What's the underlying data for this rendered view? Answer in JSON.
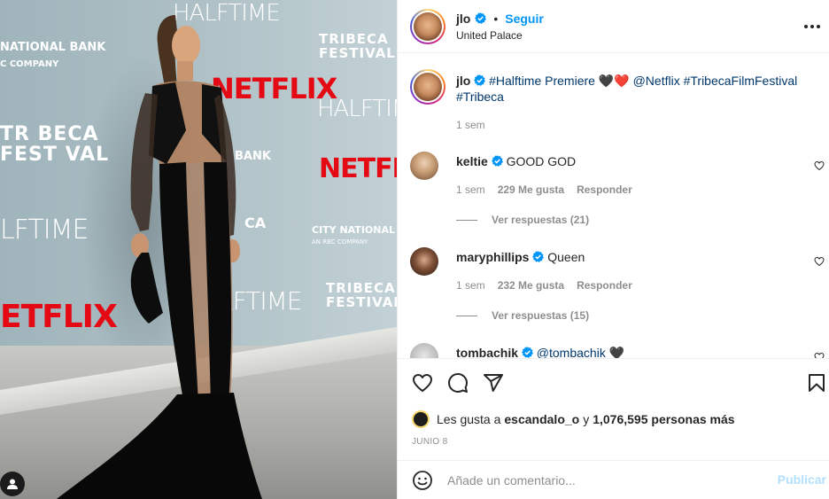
{
  "header": {
    "username": "jlo",
    "separator": "•",
    "follow_label": "Seguir",
    "location": "United Palace"
  },
  "caption": {
    "username": "jlo",
    "text_pre": "#Halftime Premiere ",
    "emojis": "🖤❤️",
    "mention": "@Netflix",
    "tags": "#TribecaFilmFestival #Tribeca",
    "time": "1 sem"
  },
  "comments": [
    {
      "username": "keltie",
      "text": "GOOD GOD",
      "time": "1 sem",
      "likes": "229 Me gusta",
      "reply_label": "Responder",
      "view_replies": "Ver respuestas (21)"
    },
    {
      "username": "maryphillips",
      "text": "Queen",
      "time": "1 sem",
      "likes": "232 Me gusta",
      "reply_label": "Responder",
      "view_replies": "Ver respuestas (15)"
    },
    {
      "username": "tombachik",
      "text": "@tombachik",
      "emoji": "🖤"
    }
  ],
  "likes": {
    "prefix": "Les gusta a ",
    "user": "escandalo_o",
    "middle": " y ",
    "count": "1,076,595 personas más"
  },
  "date": "JUNIO 8",
  "comment_box": {
    "placeholder": "Añade un comentario...",
    "post_label": "Publicar"
  },
  "photo": {
    "logos": {
      "halftime": "HALFTIME",
      "tribeca_line1": "TRIBECA",
      "tribeca_line2": "FESTIVAL",
      "netflix": "NETFLIX",
      "bank": "CITY NATIONAL BANK",
      "bank_sub": "AN RBC COMPANY",
      "national_bank": "NATIONAL BANK",
      "company": "C COMPANY",
      "half_partial": "HALFTIME",
      "tribeca_partial_1": "TRIBECA",
      "tribeca_partial_2": "ESTIVAL",
      "netflix_partial": "ETFLIX",
      "bank_partial": "BANK",
      "half_crop": "LFTIME",
      "tribeca_crop": "TR BECA",
      "tribeca_crop_2": "FEST VAL",
      "halftime_top": "HALFTIME",
      "ca": "CA"
    }
  },
  "colors": {
    "accent": "#0095f6",
    "link": "#00376b",
    "netflix_red": "#e50914",
    "muted": "#8e8e8e"
  },
  "icons": {
    "like": "heart-icon",
    "comment": "comment-icon",
    "share": "share-icon",
    "save": "bookmark-icon",
    "emoji": "emoji-icon",
    "more": "more-icon",
    "verified": "verified-badge-icon",
    "user": "user-icon"
  }
}
